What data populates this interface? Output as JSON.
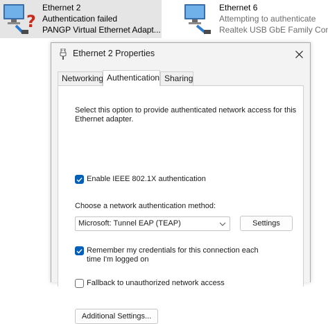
{
  "connections": [
    {
      "name": "Ethernet 2",
      "status": "Authentication failed",
      "device": "PANGP Virtual Ethernet Adapt...",
      "icon": "ethernet-error-icon"
    },
    {
      "name": "Ethernet 6",
      "status": "Attempting to authenticate",
      "device": "Realtek USB GbE Family Contr",
      "icon": "ethernet-icon"
    }
  ],
  "dialog": {
    "title": "Ethernet 2 Properties",
    "title_icon": "network-adapter-icon",
    "close_icon": "close-icon",
    "tabs": [
      "Networking",
      "Authentication",
      "Sharing"
    ],
    "active_tab": "Authentication",
    "description": "Select this option to provide authenticated network access for this Ethernet adapter.",
    "ieee_label": "Enable IEEE 802.1X authentication",
    "ieee_checked": true,
    "method_label": "Choose a network authentication method:",
    "method_value": "Microsoft: Tunnel EAP (TEAP)",
    "settings_button": "Settings",
    "remember_label": "Remember my credentials for this connection each time I'm logged on",
    "remember_checked": true,
    "fallback_label": "Fallback to unauthorized network access",
    "fallback_checked": false,
    "additional_button": "Additional Settings..."
  },
  "colors": {
    "accent": "#005fb8",
    "error": "#c42b1c",
    "selection": "#e5e5e5"
  }
}
